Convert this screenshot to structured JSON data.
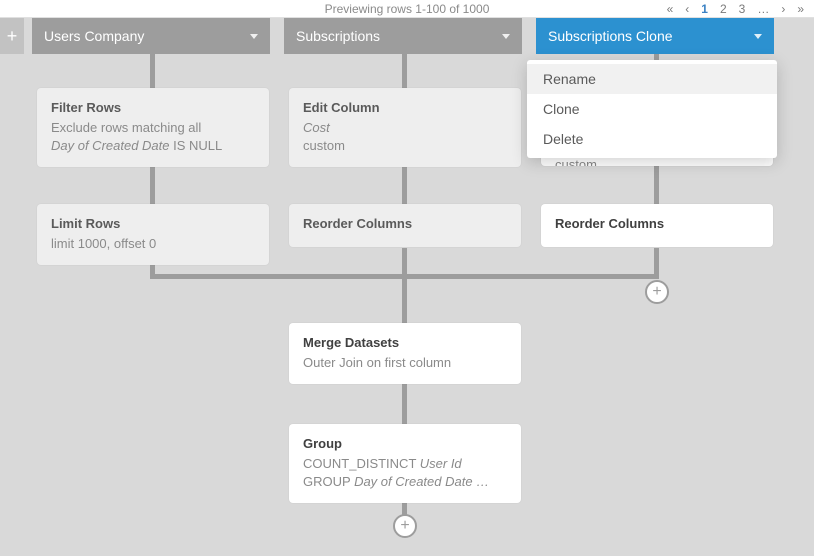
{
  "topbar": {
    "preview_text": "Previewing rows 1-100 of 1000",
    "pager": {
      "first": "«",
      "prev": "‹",
      "p1": "1",
      "p2": "2",
      "p3": "3",
      "dots": "…",
      "next": "›",
      "last": "»"
    }
  },
  "addColIcon": "+",
  "columns": [
    {
      "label": "Users Company"
    },
    {
      "label": "Subscriptions"
    },
    {
      "label": "Subscriptions Clone"
    }
  ],
  "cards": {
    "filter": {
      "title": "Filter Rows",
      "line1": "Exclude rows matching all",
      "line2a": "Day of Created Date",
      "line2b": " IS NULL"
    },
    "limit": {
      "title": "Limit Rows",
      "sub": "limit 1000, offset 0"
    },
    "edit1": {
      "title": "Edit Column",
      "sub_em": "Cost",
      "sub2": "custom"
    },
    "reorder1": {
      "title": "Reorder Columns"
    },
    "edit2_custom": "custom",
    "reorder2": {
      "title": "Reorder Columns"
    },
    "merge": {
      "title": "Merge Datasets",
      "sub": "Outer Join on first column"
    },
    "group": {
      "title": "Group",
      "line1a": "COUNT_DISTINCT ",
      "line1b": "User Id",
      "line2a": "GROUP ",
      "line2b": "Day of Created Date …"
    }
  },
  "dropdown": {
    "rename": "Rename",
    "clone": "Clone",
    "delete": "Delete"
  },
  "plus": "+"
}
